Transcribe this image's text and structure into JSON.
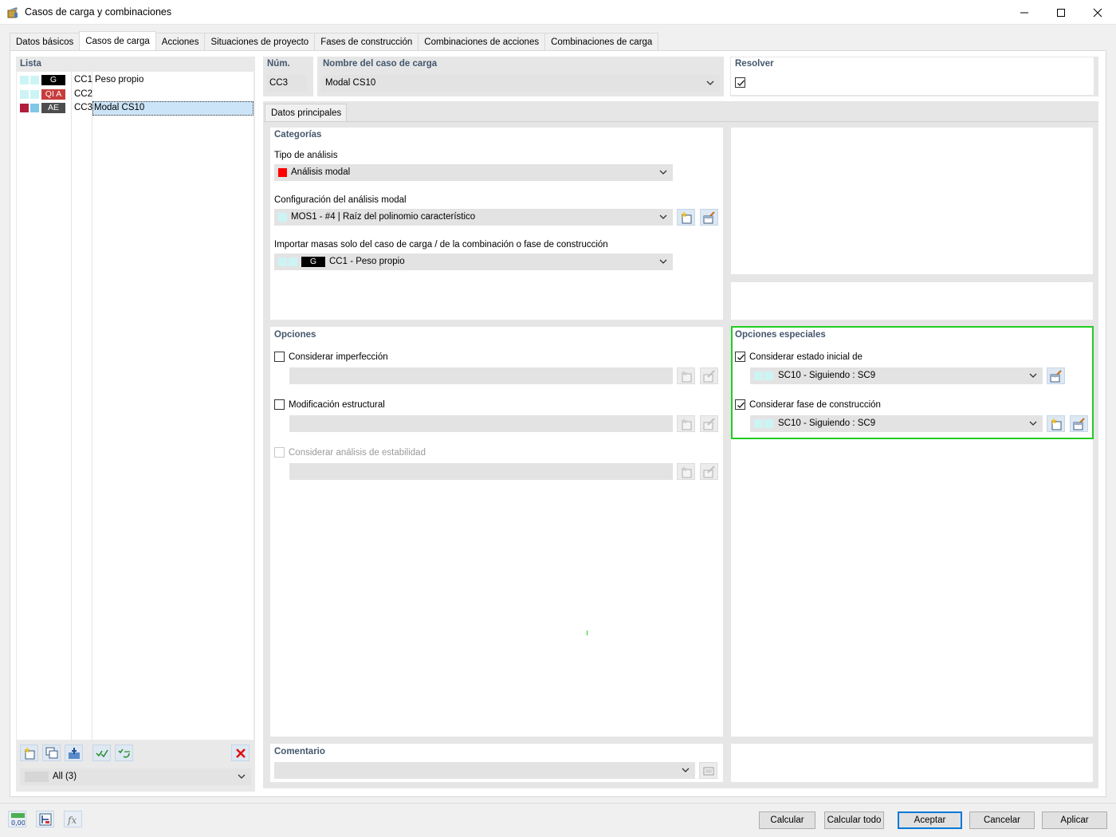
{
  "window": {
    "title": "Casos de carga y combinaciones"
  },
  "tabs": [
    {
      "label": "Datos básicos"
    },
    {
      "label": "Casos de carga"
    },
    {
      "label": "Acciones"
    },
    {
      "label": "Situaciones de proyecto"
    },
    {
      "label": "Fases de construcción"
    },
    {
      "label": "Combinaciones de acciones"
    },
    {
      "label": "Combinaciones de carga"
    }
  ],
  "list": {
    "title": "Lista",
    "items": [
      {
        "tag": "G",
        "tag_color": "#000000",
        "id": "CC1",
        "name": "Peso propio"
      },
      {
        "tag": "QI A",
        "tag_color": "#c83c3c",
        "id": "CC2",
        "name": ""
      },
      {
        "tag": "AE",
        "tag_color": "#4d4d4d",
        "id": "CC3",
        "name": "Modal CS10"
      }
    ],
    "filter": "All (3)"
  },
  "header": {
    "num_label": "Núm.",
    "num_value": "CC3",
    "name_label": "Nombre del caso de carga",
    "name_value": "Modal CS10",
    "resolve_label": "Resolver",
    "resolve_checked": true
  },
  "subtab": "Datos principales",
  "categories": {
    "title": "Categorías",
    "analysis_type_label": "Tipo de análisis",
    "analysis_type_value": "Análisis modal",
    "analysis_color": "#ff0000",
    "modal_config_label": "Configuración del análisis modal",
    "modal_config_value": "MOS1 - #4 | Raíz del polinomio característico",
    "import_masses_label": "Importar masas solo del caso de carga / de la combinación o fase de construcción",
    "import_masses_tag": "G",
    "import_masses_value": "CC1 - Peso propio"
  },
  "options": {
    "title": "Opciones",
    "imperfection_label": "Considerar imperfección",
    "structural_mod_label": "Modificación estructural",
    "stability_label": "Considerar análisis de estabilidad"
  },
  "special_options": {
    "title": "Opciones especiales",
    "initial_state_label": "Considerar estado inicial de",
    "initial_state_checked": true,
    "initial_state_value": "SC10 - Siguiendo : SC9",
    "construction_stage_label": "Considerar fase de construcción",
    "construction_stage_checked": true,
    "construction_stage_value": "SC10 - Siguiendo : SC9",
    "highlight_color": "#22cc22"
  },
  "comment": {
    "title": "Comentario",
    "value": ""
  },
  "buttons": {
    "calcular": "Calcular",
    "calcular_todo": "Calcular todo",
    "aceptar": "Aceptar",
    "cancelar": "Cancelar",
    "aplicar": "Aplicar"
  },
  "bottom_icons": {
    "units_icon_text": "0,00"
  }
}
